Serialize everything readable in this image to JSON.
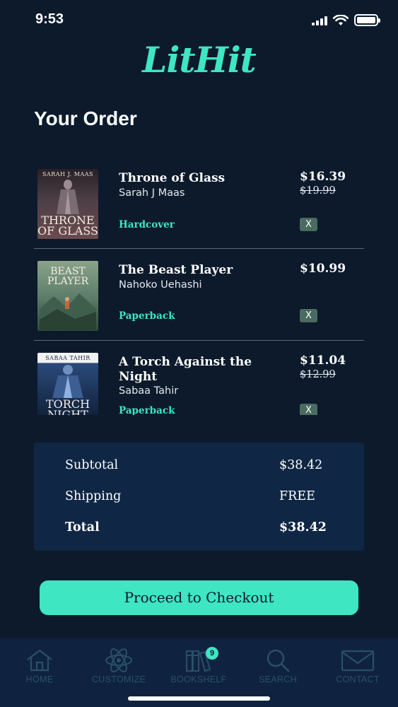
{
  "status_bar": {
    "time": "9:53"
  },
  "app": {
    "logo": "LitHit"
  },
  "page": {
    "title": "Your Order"
  },
  "order": {
    "items": [
      {
        "title": "Throne of Glass",
        "author": "Sarah J Maas",
        "format": "Hardcover",
        "price": "$16.39",
        "original_price": "$19.99",
        "remove_label": "X",
        "cover": {
          "author_text": "SARAH J. MAAS",
          "title_text": "THRONE OF GLASS",
          "colors": [
            "#3a2a2e",
            "#6a5a62",
            "#8b3a3a"
          ]
        }
      },
      {
        "title": "The Beast Player",
        "author": "Nahoko Uehashi",
        "format": "Paperback",
        "price": "$10.99",
        "original_price": "",
        "remove_label": "X",
        "cover": {
          "author_text": "",
          "title_text": "BEAST PLAYER",
          "colors": [
            "#5e7f6a",
            "#8aa38a",
            "#2f4b3a"
          ]
        }
      },
      {
        "title": "A Torch Against the Night",
        "author": "Sabaa Tahir",
        "format": "Paperback",
        "price": "$11.04",
        "original_price": "$12.99",
        "remove_label": "X",
        "cover": {
          "author_text": "SABAA TAHIR",
          "title_text": "TORCH NIGHT",
          "colors": [
            "#0e1c33",
            "#2a4a7a",
            "#6f8fc0"
          ]
        }
      }
    ]
  },
  "summary": {
    "subtotal_label": "Subtotal",
    "subtotal_value": "$38.42",
    "shipping_label": "Shipping",
    "shipping_value": "FREE",
    "total_label": "Total",
    "total_value": "$38.42"
  },
  "checkout": {
    "label": "Proceed to Checkout"
  },
  "tab_bar": {
    "tabs": [
      {
        "label": "HOME",
        "icon": "home-icon"
      },
      {
        "label": "CUSTOMIZE",
        "icon": "atom-icon"
      },
      {
        "label": "BOOKSHELF",
        "icon": "books-icon",
        "badge": "9"
      },
      {
        "label": "SEARCH",
        "icon": "search-icon"
      },
      {
        "label": "CONTACT",
        "icon": "mail-icon"
      }
    ]
  },
  "colors": {
    "background": "#0c1a2c",
    "accent": "#3ee6c1",
    "summary_panel": "#0f2744",
    "tab_bar": "#0f2340",
    "tab_inactive": "#2a4f68",
    "remove_button": "#4a6b5f"
  }
}
